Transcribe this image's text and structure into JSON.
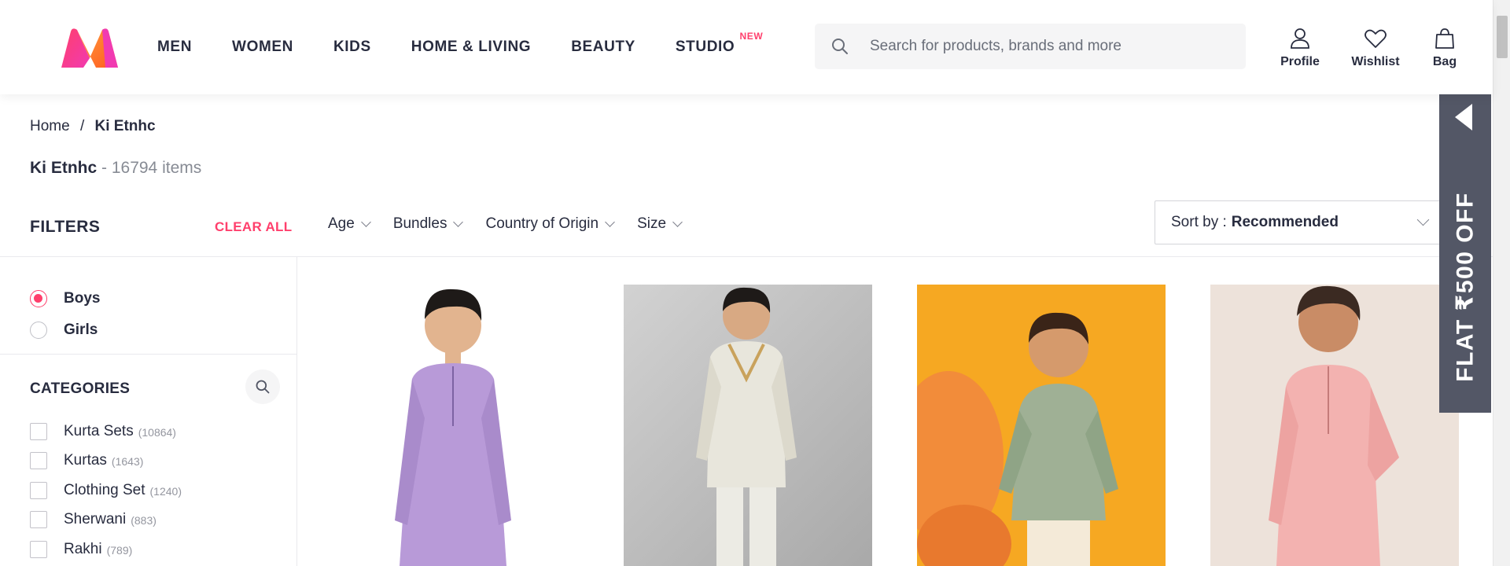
{
  "header": {
    "nav": [
      {
        "label": "MEN"
      },
      {
        "label": "WOMEN"
      },
      {
        "label": "KIDS"
      },
      {
        "label": "HOME & LIVING"
      },
      {
        "label": "BEAUTY"
      },
      {
        "label": "STUDIO",
        "badge": "NEW"
      }
    ],
    "search": {
      "placeholder": "Search for products, brands and more",
      "icon": "search-icon"
    },
    "actions": [
      {
        "label": "Profile",
        "icon": "profile-icon"
      },
      {
        "label": "Wishlist",
        "icon": "heart-icon"
      },
      {
        "label": "Bag",
        "icon": "bag-icon"
      }
    ]
  },
  "breadcrumb": {
    "home": "Home",
    "separator": "/",
    "current": "Ki Etnhc"
  },
  "title": {
    "brand": "Ki Etnhc",
    "count": " - 16794 items"
  },
  "filters": {
    "title": "FILTERS",
    "clear_all": "CLEAR ALL",
    "horizontal": [
      "Age",
      "Bundles",
      "Country of Origin",
      "Size"
    ],
    "gender": [
      {
        "label": "Boys",
        "selected": true
      },
      {
        "label": "Girls",
        "selected": false
      }
    ],
    "categories_title": "CATEGORIES",
    "categories": [
      {
        "label": "Kurta Sets",
        "count": "(10864)"
      },
      {
        "label": "Kurtas",
        "count": "(1643)"
      },
      {
        "label": "Clothing Set",
        "count": "(1240)"
      },
      {
        "label": "Sherwani",
        "count": "(883)"
      },
      {
        "label": "Rakhi",
        "count": "(789)"
      }
    ]
  },
  "sort": {
    "prefix": "Sort by :",
    "value": "Recommended"
  },
  "products": [
    {
      "image": "boy-lavender-kurta",
      "bg": "#ffffff",
      "outfit": "#b89ad8"
    },
    {
      "image": "boy-cream-sherwani",
      "bg": "#b8b8b8",
      "outfit": "#e8e6dc"
    },
    {
      "image": "toddler-green-print-shirt",
      "bg": "#f6a822",
      "outfit": "#8fa486"
    },
    {
      "image": "boy-pink-kurta",
      "bg": "#ede2da",
      "outfit": "#f3b2b0"
    }
  ],
  "banner": {
    "text": "FLAT ₹500 OFF",
    "bg": "#535766"
  },
  "colors": {
    "accent": "#ff3f6c",
    "text": "#282c3f"
  }
}
